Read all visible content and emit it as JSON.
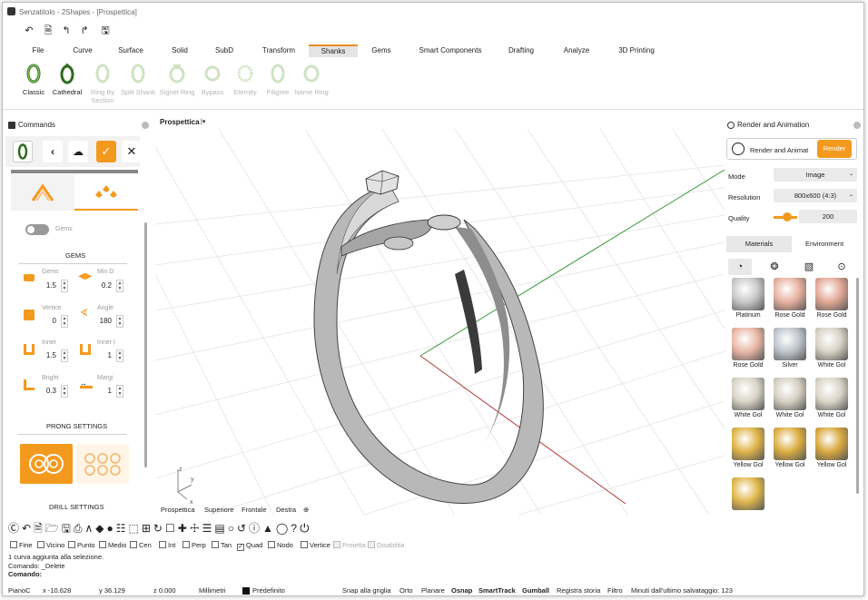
{
  "window": {
    "title": "Senzatitolo - 2Shapes - [Prospettica]"
  },
  "quick_access": [
    "undo-icon",
    "new-icon",
    "back-icon",
    "redo-icon",
    "save-icon"
  ],
  "menus": [
    "File",
    "Curve",
    "Surface",
    "Solid",
    "SubD",
    "Transform",
    "Shanks",
    "Gems",
    "Smart Components",
    "Drafting",
    "Analyze",
    "3D Printing"
  ],
  "active_menu": "Shanks",
  "ribbon": [
    {
      "label": "Classic",
      "enabled": true
    },
    {
      "label": "Cathedral",
      "enabled": true
    },
    {
      "label": "Ring By Section",
      "enabled": false
    },
    {
      "label": "Split Shank",
      "enabled": false
    },
    {
      "label": "Signet Ring",
      "enabled": false
    },
    {
      "label": "Bypass",
      "enabled": false
    },
    {
      "label": "Eternity",
      "enabled": false
    },
    {
      "label": "Filigree",
      "enabled": false
    },
    {
      "label": "Name Ring",
      "enabled": false
    }
  ],
  "commands_panel": {
    "title": "Commands",
    "gems_toggle_label": "Gems",
    "gems_section": "GEMS",
    "fields": [
      {
        "label": "Gems",
        "value": "1.5"
      },
      {
        "label": "Min D",
        "value": "0.2"
      },
      {
        "label": "Vertice",
        "value": "0"
      },
      {
        "label": "Angle",
        "value": "180"
      },
      {
        "label": "Inner",
        "value": "1.5"
      },
      {
        "label": "Inner I",
        "value": "1"
      },
      {
        "label": "Bright",
        "value": "0.3"
      },
      {
        "label": "Margi",
        "value": "1"
      }
    ],
    "prong_section": "PRONG SETTINGS",
    "drill_section": "DRILL SETTINGS"
  },
  "viewport": {
    "name": "Prospettica",
    "tabs": [
      "Prospettica",
      "Superiore",
      "Frontale",
      "Destra"
    ],
    "add_tab_icon": "plus-icon",
    "axis_x": "x",
    "axis_y": "y",
    "axis_z": "z"
  },
  "render_panel": {
    "title": "Render and Animation",
    "render_button_label": "Render and Animat",
    "render_button": "Render",
    "mode_label": "Mode",
    "mode_value": "Image",
    "resolution_label": "Resolution",
    "resolution_value": "800x600 (4:3)",
    "quality_label": "Quality",
    "quality_value": "200",
    "quality_level": 0.25,
    "tab_materials": "Materials",
    "tab_environment": "Environment",
    "materials": [
      {
        "name": "Platinum",
        "color": "#c9c9c9"
      },
      {
        "name": "Rose Gold",
        "color": "#e8b2a0"
      },
      {
        "name": "Rose Gold",
        "color": "#e2a796"
      },
      {
        "name": "Rose Gold",
        "color": "#e9b7a6"
      },
      {
        "name": "Silver",
        "color": "#bfc4cc"
      },
      {
        "name": "White Gol",
        "color": "#d7d2c4"
      },
      {
        "name": "White Gol",
        "color": "#d9d4c6"
      },
      {
        "name": "White Gol",
        "color": "#d5d0c2"
      },
      {
        "name": "White Gol",
        "color": "#dad5c8"
      },
      {
        "name": "Yellow Gol",
        "color": "#e0b54a"
      },
      {
        "name": "Yellow Gol",
        "color": "#dcae42"
      },
      {
        "name": "Yellow Gol",
        "color": "#d9a93f"
      },
      {
        "name": "",
        "color": "#e1b84e"
      }
    ]
  },
  "snaps": [
    {
      "label": "Fine",
      "checked": false,
      "enabled": true
    },
    {
      "label": "Vicino",
      "checked": false,
      "enabled": true
    },
    {
      "label": "Punto",
      "checked": false,
      "enabled": true
    },
    {
      "label": "Medio",
      "checked": false,
      "enabled": true
    },
    {
      "label": "Cen",
      "checked": false,
      "enabled": true
    },
    {
      "label": "Int",
      "checked": false,
      "enabled": true
    },
    {
      "label": "Perp",
      "checked": false,
      "enabled": true
    },
    {
      "label": "Tan",
      "checked": false,
      "enabled": true
    },
    {
      "label": "Quad",
      "checked": true,
      "enabled": true
    },
    {
      "label": "Nodo",
      "checked": false,
      "enabled": true
    },
    {
      "label": "Vertice",
      "checked": false,
      "enabled": true
    },
    {
      "label": "Proietta",
      "checked": false,
      "enabled": false
    },
    {
      "label": "Disabilita",
      "checked": false,
      "enabled": false
    }
  ],
  "command_history": [
    "1 curva aggiunta alla selezione.",
    "Comando: _Delete"
  ],
  "command_prompt": "Comando:",
  "status": {
    "plane": "PianoC",
    "x": "x -10.628",
    "y": "y 36.129",
    "z": "z 0.000",
    "units": "Millimetri",
    "layer": "Predefinito",
    "toggles": [
      {
        "label": "Snap alla griglia",
        "bold": false
      },
      {
        "label": "Orto",
        "bold": false
      },
      {
        "label": "Planare",
        "bold": false
      },
      {
        "label": "Osnap",
        "bold": true
      },
      {
        "label": "SmartTrack",
        "bold": true
      },
      {
        "label": "Gumball",
        "bold": true
      },
      {
        "label": "Registra storia",
        "bold": false
      },
      {
        "label": "Filtro",
        "bold": false
      }
    ],
    "last_save": "Minuti dall'ultimo salvataggio: 123"
  },
  "colors": {
    "accent": "#f39a1e",
    "x_axis": "#b33a3a",
    "y_axis": "#3a9a3a"
  }
}
